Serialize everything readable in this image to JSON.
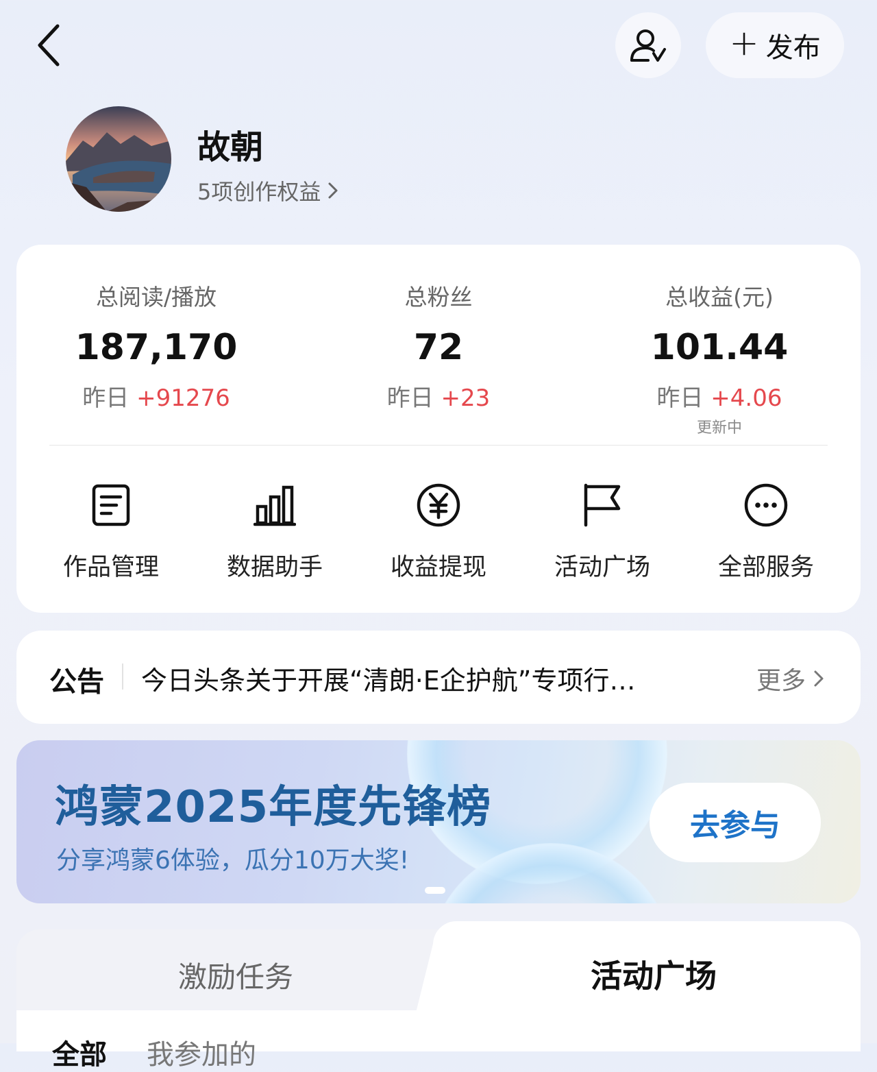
{
  "header": {
    "back_icon": "chevron-left-icon",
    "follow_icon": "user-check-icon",
    "publish_label": "发布",
    "publish_plus": "+"
  },
  "profile": {
    "name": "故朝",
    "rights_label": "5项创作权益",
    "rights_chevron": "›"
  },
  "stats": [
    {
      "label": "总阅读/播放",
      "value": "187,170",
      "delta_prefix": "昨日 ",
      "delta": "+91276"
    },
    {
      "label": "总粉丝",
      "value": "72",
      "delta_prefix": "昨日 ",
      "delta": "+23"
    },
    {
      "label": "总收益(元)",
      "value": "101.44",
      "delta_prefix": "昨日 ",
      "delta": "+4.06",
      "note": "更新中"
    }
  ],
  "services": [
    {
      "label": "作品管理",
      "icon": "document-icon"
    },
    {
      "label": "数据助手",
      "icon": "bar-chart-icon"
    },
    {
      "label": "收益提现",
      "icon": "yuan-icon"
    },
    {
      "label": "活动广场",
      "icon": "flag-icon"
    },
    {
      "label": "全部服务",
      "icon": "more-icon"
    }
  ],
  "notice": {
    "title": "公告",
    "text": "今日头条关于开展“清朗·E企护航”专项行…",
    "more": "更多"
  },
  "banner": {
    "title": "鸿蒙2025年度先锋榜",
    "subtitle": "分享鸿蒙6体验，瓜分10万大奖!",
    "button": "去参与"
  },
  "tabs": {
    "left": "激励任务",
    "right": "活动广场",
    "active": "活动广场",
    "filter_all": "全部",
    "filter_mine": "我参加的"
  },
  "colors": {
    "accent_red": "#e5484d",
    "banner_title": "#1f5e9b",
    "banner_button": "#1e73c8"
  }
}
